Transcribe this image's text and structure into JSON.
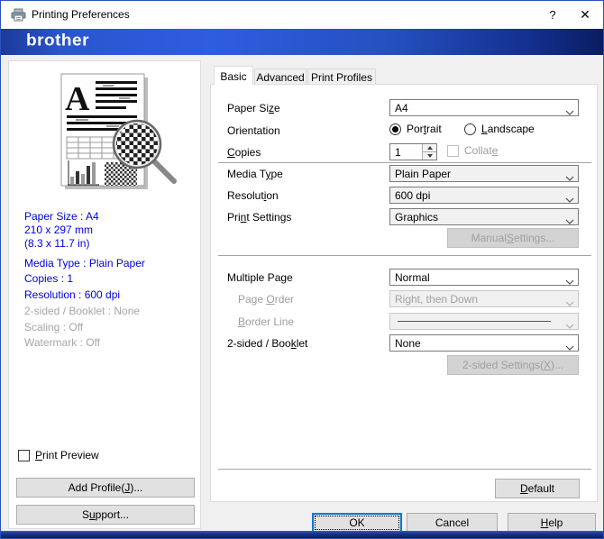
{
  "colors": {
    "accent_blue": "#0078d7",
    "banner_blue_bright": "#2f5de0",
    "banner_blue_dark": "#0a1d61",
    "info_text_blue": "#0000e0",
    "disabled_text": "#9d9d9d"
  },
  "icons": {
    "titlebar": "printer-icon",
    "combo": "chevron-down-icon",
    "spinner_up": "triangle-up-icon",
    "spinner_down": "triangle-down-icon"
  },
  "window": {
    "title": "Printing Preferences",
    "help_button": "?",
    "close_button": "✕"
  },
  "brand": {
    "logo": "brother"
  },
  "sidebar": {
    "summary": [
      {
        "text": "Paper Size : A4"
      },
      {
        "text": "210 x 297 mm"
      },
      {
        "text": "(8.3 x 11.7 in)"
      },
      {
        "text": "Media Type : Plain Paper"
      },
      {
        "text": "Copies : 1"
      },
      {
        "text": "Resolution : 600 dpi"
      },
      {
        "text": "2-sided / Booklet : None"
      },
      {
        "text": "Scaling : Off"
      },
      {
        "text": "Watermark : Off"
      }
    ],
    "print_preview": {
      "label": "&Print Preview",
      "checked": false
    },
    "add_profile_button": "Add Profile(&J)...",
    "support_button": "S&upport..."
  },
  "tabs": {
    "items": [
      {
        "label": "Basic",
        "active": true
      },
      {
        "label": "Advanced",
        "active": false
      },
      {
        "label": "Print Profiles",
        "active": false
      }
    ]
  },
  "form": {
    "paper_size": {
      "label": "Paper Si&ze",
      "value": "A4"
    },
    "orientation": {
      "label": "Orientation",
      "portrait": {
        "label": "Por&trait",
        "selected": true
      },
      "landscape": {
        "label": "&Landscape",
        "selected": false
      }
    },
    "copies": {
      "label": "&Copies",
      "value": "1",
      "collate": {
        "label": "Collat&e",
        "checked": false,
        "enabled": false
      }
    },
    "media_type": {
      "label": "Media T&ype",
      "value": "Plain Paper"
    },
    "resolution": {
      "label": "Resolut&ion",
      "value": "600 dpi"
    },
    "print_settings": {
      "label": "Pri&nt Settings",
      "value": "Graphics",
      "manual_settings_button": {
        "label": "Manual &Settings...",
        "enabled": false
      }
    },
    "multiple_page": {
      "label": "Multiple Pa&ge",
      "value": "Normal"
    },
    "page_order": {
      "label": "Page &Order",
      "value": "Right, then Down",
      "enabled": false
    },
    "border_line": {
      "label": "&Border Line",
      "value_kind": "solid-line-sample",
      "enabled": false
    },
    "two_sided": {
      "label": "2-sided / Boo&klet",
      "value": "None",
      "settings_button": {
        "label": "2-sided Settings(&X)...",
        "enabled": false
      }
    },
    "default_button": "&Default"
  },
  "footer": {
    "ok": "OK",
    "cancel": "Cancel",
    "help": "&Help"
  }
}
